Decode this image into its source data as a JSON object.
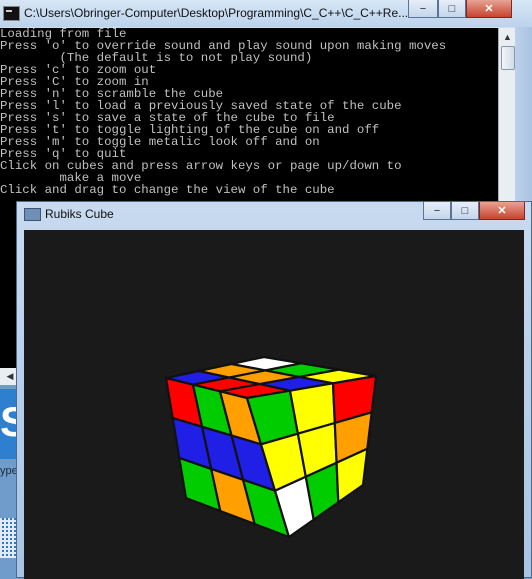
{
  "console": {
    "title": "C:\\Users\\Obringer-Computer\\Desktop\\Programming\\C_C++\\C_C++Re...",
    "lines": [
      "Loading from file",
      "Press 'o' to override sound and play sound upon making moves",
      "        (The default is to not play sound)",
      "Press 'c' to zoom out",
      "Press 'C' to zoom in",
      "Press 'n' to scramble the cube",
      "Press 'l' to load a previously saved state of the cube",
      "Press 's' to save a state of the cube to file",
      "Press 't' to toggle lighting of the cube on and off",
      "Press 'm' to toggle metalic look off and on",
      "Press 'q' to quit",
      "Click on cubes and press arrow keys or page up/down to",
      "        make a move",
      "Click and drag to change the view of the cube"
    ],
    "minimize_symbol": "−",
    "maximize_symbol": "□",
    "close_symbol": "✕"
  },
  "desktop": {
    "glyph": "S",
    "text": "ype"
  },
  "rubiks": {
    "title": "Rubiks Cube",
    "minimize_symbol": "−",
    "maximize_symbol": "□",
    "close_symbol": "✕"
  },
  "colors": {
    "red": "#ff0000",
    "green": "#00cc00",
    "blue": "#1f1fe6",
    "yellow": "#ffff00",
    "orange": "#ffa000",
    "white": "#ffffff",
    "background": "#1a1a1a"
  },
  "cube": {
    "top": [
      [
        "white",
        "green",
        "yellow"
      ],
      [
        "orange",
        "orange",
        "blue"
      ],
      [
        "blue",
        "red",
        "red"
      ]
    ],
    "left": [
      [
        "red",
        "green",
        "orange"
      ],
      [
        "blue",
        "blue",
        "blue"
      ],
      [
        "green",
        "orange",
        "green"
      ]
    ],
    "right": [
      [
        "green",
        "yellow",
        "red"
      ],
      [
        "yellow",
        "yellow",
        "orange"
      ],
      [
        "white",
        "green",
        "yellow"
      ]
    ]
  }
}
